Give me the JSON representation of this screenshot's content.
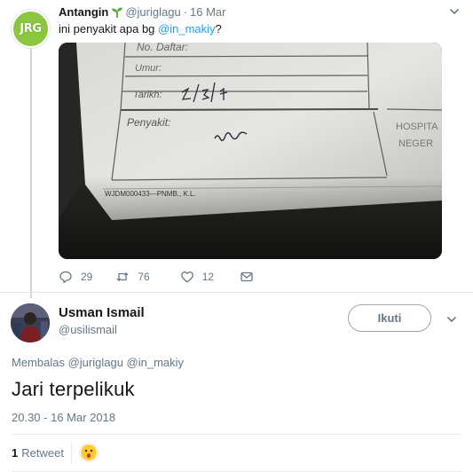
{
  "parent_tweet": {
    "display_name": "Antangin",
    "handle": "@juriglagu",
    "separator": "·",
    "date": "16 Mar",
    "avatar_text": "JRG",
    "text_before": "ini penyakit apa bg ",
    "text_mention": "@in_makiy",
    "text_after": "?",
    "photo": {
      "form_fields": [
        "No. Daftar:",
        "Umur:",
        "Tarikh:",
        "Penyakit:"
      ],
      "tarikh_handwriting": "2/3/17",
      "penyakit_handwriting": "~~~",
      "side_text": [
        "HOSPITA",
        "NEGER"
      ],
      "footer_code": "WJDM000433—PNMB., K.L."
    },
    "actions": {
      "reply_count": "29",
      "retweet_count": "76",
      "like_count": "12"
    }
  },
  "main_tweet": {
    "display_name": "Usman Ismail",
    "handle": "@usilismail",
    "follow_label": "Ikuti",
    "replying_prefix": "Membalas ",
    "replying_to_1": "@juriglagu",
    "replying_to_2": "@in_makiy",
    "text": "Jari terpelikuk",
    "timestamp": "20.30 - 16 Mar 2018",
    "retweet_count": "1",
    "retweet_label": "Retweet"
  },
  "colors": {
    "accent": "#1da1f2",
    "muted": "#657786",
    "jrg_green": "#8cc63f"
  },
  "icons": {
    "reply": "reply-icon",
    "retweet": "retweet-icon",
    "like": "heart-icon",
    "dm": "envelope-icon",
    "caret": "chevron-down-icon",
    "verified": "sprout-icon"
  }
}
